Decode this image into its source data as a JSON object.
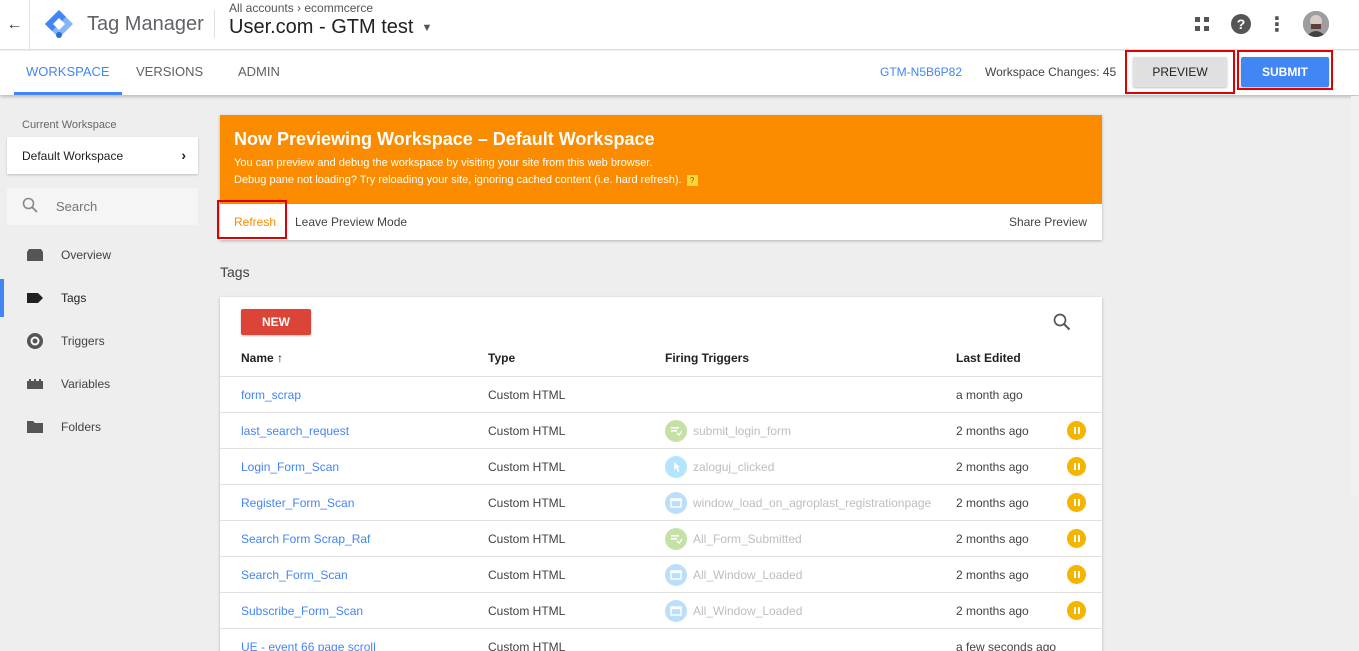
{
  "header": {
    "app_name": "Tag Manager",
    "breadcrumb": "All accounts › ecommcerce",
    "container_name": "User.com - GTM test"
  },
  "subnav": {
    "tabs": [
      {
        "label": "WORKSPACE",
        "active": true
      },
      {
        "label": "VERSIONS",
        "active": false
      },
      {
        "label": "ADMIN",
        "active": false
      }
    ],
    "container_id": "GTM-N5B6P82",
    "workspace_changes": "Workspace Changes: 45",
    "preview_label": "PREVIEW",
    "submit_label": "SUBMIT"
  },
  "sidebar": {
    "current_workspace_label": "Current Workspace",
    "current_workspace": "Default Workspace",
    "search_placeholder": "Search",
    "items": [
      {
        "label": "Overview",
        "icon": "overview-icon",
        "active": false
      },
      {
        "label": "Tags",
        "icon": "tag-icon",
        "active": true
      },
      {
        "label": "Triggers",
        "icon": "trigger-icon",
        "active": false
      },
      {
        "label": "Variables",
        "icon": "variables-icon",
        "active": false
      },
      {
        "label": "Folders",
        "icon": "folder-icon",
        "active": false
      }
    ]
  },
  "preview_banner": {
    "title": "Now Previewing Workspace – Default Workspace",
    "line1": "You can preview and debug the workspace by visiting your site from this web browser.",
    "line2": "Debug pane not loading? Try reloading your site, ignoring cached content (i.e. hard refresh).",
    "refresh_label": "Refresh",
    "leave_label": "Leave Preview Mode",
    "share_label": "Share Preview"
  },
  "tags": {
    "heading": "Tags",
    "new_label": "NEW",
    "columns": {
      "name": "Name",
      "type": "Type",
      "triggers": "Firing Triggers",
      "edited": "Last Edited"
    },
    "sort_indicator": "↑",
    "rows": [
      {
        "name": "form_scrap",
        "type": "Custom HTML",
        "trigger": "",
        "trigger_icon": "",
        "edited": "a month ago",
        "paused": false
      },
      {
        "name": "last_search_request",
        "type": "Custom HTML",
        "trigger": "submit_login_form",
        "trigger_icon": "form-submit-icon",
        "edited": "2 months ago",
        "paused": true
      },
      {
        "name": "Login_Form_Scan",
        "type": "Custom HTML",
        "trigger": "zaloguj_clicked",
        "trigger_icon": "click-icon",
        "edited": "2 months ago",
        "paused": true
      },
      {
        "name": "Register_Form_Scan",
        "type": "Custom HTML",
        "trigger": "window_load_on_agroplast_registrationpage",
        "trigger_icon": "window-load-icon",
        "edited": "2 months ago",
        "paused": true
      },
      {
        "name": "Search Form Scrap_Raf",
        "type": "Custom HTML",
        "trigger": "All_Form_Submitted",
        "trigger_icon": "form-submit-icon",
        "edited": "2 months ago",
        "paused": true
      },
      {
        "name": "Search_Form_Scan",
        "type": "Custom HTML",
        "trigger": "All_Window_Loaded",
        "trigger_icon": "window-load-icon",
        "edited": "2 months ago",
        "paused": true
      },
      {
        "name": "Subscribe_Form_Scan",
        "type": "Custom HTML",
        "trigger": "All_Window_Loaded",
        "trigger_icon": "window-load-icon",
        "edited": "2 months ago",
        "paused": true
      },
      {
        "name": "UE - event 66 page scroll",
        "type": "Custom HTML",
        "trigger": "",
        "trigger_icon": "",
        "edited": "a few seconds ago",
        "paused": false
      }
    ]
  },
  "colors": {
    "accent_blue": "#4285f4",
    "banner_orange": "#fb8c00",
    "new_red": "#db4437",
    "pause_yellow": "#f4b400",
    "highlight_red": "#e00000"
  }
}
